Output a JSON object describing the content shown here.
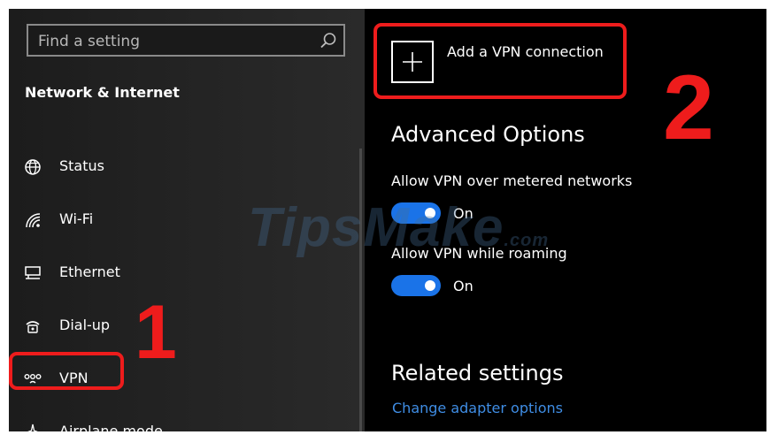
{
  "search": {
    "placeholder": "Find a setting",
    "icon": "search-icon"
  },
  "sidebar": {
    "section_title": "Network & Internet",
    "items": [
      {
        "label": "Status",
        "icon": "globe-icon"
      },
      {
        "label": "Wi-Fi",
        "icon": "wifi-icon"
      },
      {
        "label": "Ethernet",
        "icon": "ethernet-icon"
      },
      {
        "label": "Dial-up",
        "icon": "dial-up-icon"
      },
      {
        "label": "VPN",
        "icon": "vpn-icon"
      },
      {
        "label": "Airplane mode",
        "icon": "airplane-icon"
      }
    ]
  },
  "main": {
    "add_vpn_label": "Add a VPN connection",
    "advanced_title": "Advanced Options",
    "options": [
      {
        "label": "Allow VPN over metered networks",
        "state": "On"
      },
      {
        "label": "Allow VPN while roaming",
        "state": "On"
      }
    ],
    "related_title": "Related settings",
    "related_link": "Change adapter options"
  },
  "annotations": {
    "step1": "1",
    "step2": "2",
    "color": "#ee1c1c"
  },
  "watermark": {
    "text": "TipsMake",
    "suffix": ".com"
  },
  "colors": {
    "accent": "#1a73e8",
    "link": "#3f8de4",
    "sidebar_bg": "#222222",
    "main_bg": "#000000"
  }
}
